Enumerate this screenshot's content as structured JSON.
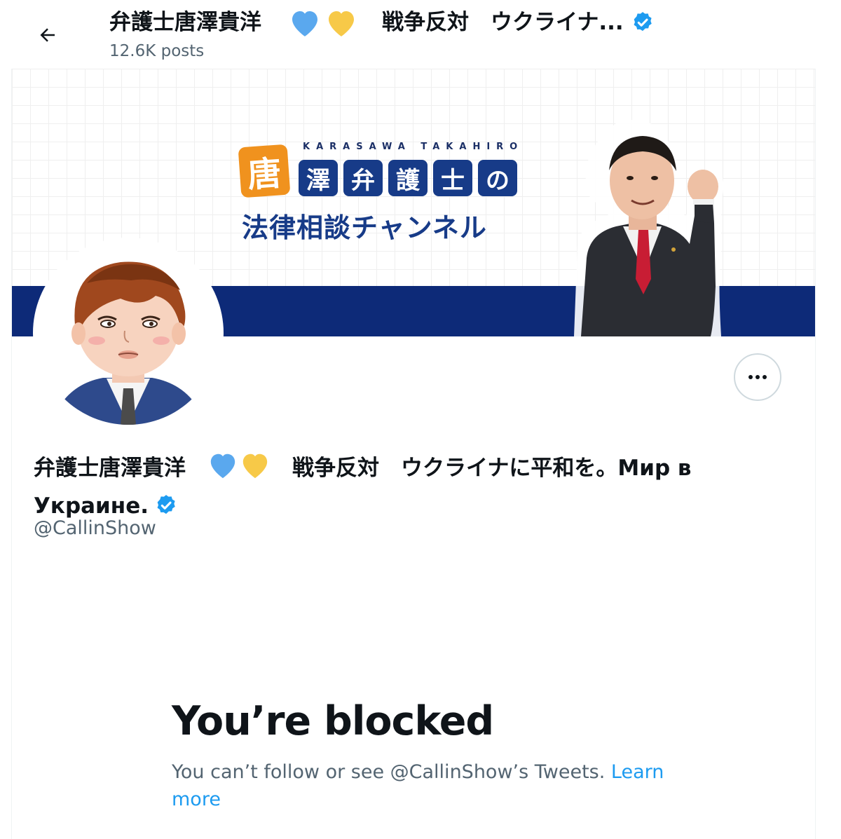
{
  "header": {
    "title_name": "弁護士唐澤貴洋",
    "title_rest": "戦争反対　ウクライナ...",
    "posts": "12.6K posts"
  },
  "banner": {
    "en_name": "KARASAWA TAKAHIRO",
    "tile_first": "唐",
    "tiles": [
      "澤",
      "弁",
      "護",
      "士",
      "の"
    ],
    "subtitle": "法律相談チャンネル"
  },
  "profile": {
    "name_prefix": "弁護士唐澤貴洋",
    "name_suffix": "戦争反対　ウクライナに平和を。Мир в Украине.",
    "handle": "@CallinShow"
  },
  "blocked": {
    "title": "You’re blocked",
    "message": "You can’t follow or see @CallinShow’s Tweets. ",
    "link": "Learn more"
  },
  "colors": {
    "accent": "#1d9bf0",
    "heart_blue": "#5aa8ee",
    "heart_yellow": "#f7c948",
    "banner_navy": "#0d2a78"
  }
}
